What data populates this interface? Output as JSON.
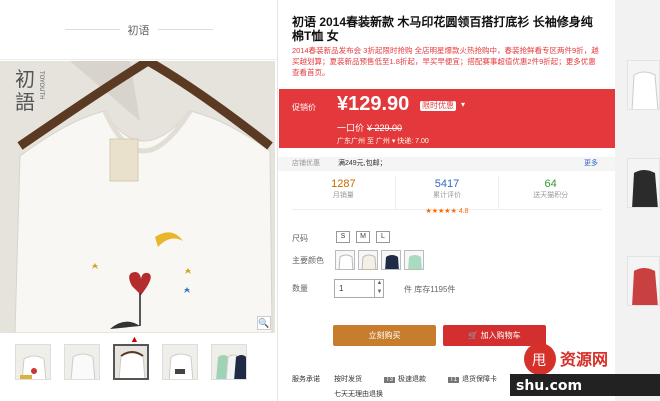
{
  "gallery": {
    "brand": "初语",
    "logo_text": "初語",
    "logo_sub": "TOYOUTH"
  },
  "product": {
    "title": "初语 2014春装新款 木马印花圆领百搭打底衫 长袖修身纯棉T恤 女",
    "subtitle": "2014春装新品发布会 3折起限时抢购 全店明星爆款火热抢购中，春装抢鲜看专区两件9折，越买越划算；夏装新品预售低至1.8折起，早买早便宜；搭配赛事超值优惠2件9折起；更多优惠 查看首页。",
    "price_label": "促销价",
    "price": "¥129.90",
    "badge": "限时优惠",
    "orig_label": "一口价",
    "orig_price": "¥ 229.00",
    "ship": "广东广州 至 广州 ▾  快递: 7.00",
    "promo_label": "店铺优惠",
    "promo_value": "满249元,包邮；",
    "promo_more": "更多",
    "stats": [
      {
        "num": "1287",
        "cap": "月销量"
      },
      {
        "num": "5417",
        "cap": "累计评价"
      },
      {
        "num": "64",
        "cap": "送天猫积分"
      }
    ],
    "rating": "4.8",
    "size_label": "尺码",
    "sizes": [
      "S",
      "M",
      "L"
    ],
    "color_label": "主要颜色",
    "qty_label": "数量",
    "qty_value": "1",
    "stock": "件  库存1195件",
    "buy_now": "立刻购买",
    "add_cart": "加入购物车",
    "service_label": "服务承诺",
    "service_1": "按时发货",
    "service_2": "极速退款",
    "service_3": "退货保障卡",
    "service_4": "七天无理由退换",
    "tag_2": "T3",
    "tag_3": "T1"
  },
  "colors": {
    "accent_red": "#e4393c",
    "buy_orange": "#c87d2c",
    "cart_red": "#d42f2f"
  }
}
